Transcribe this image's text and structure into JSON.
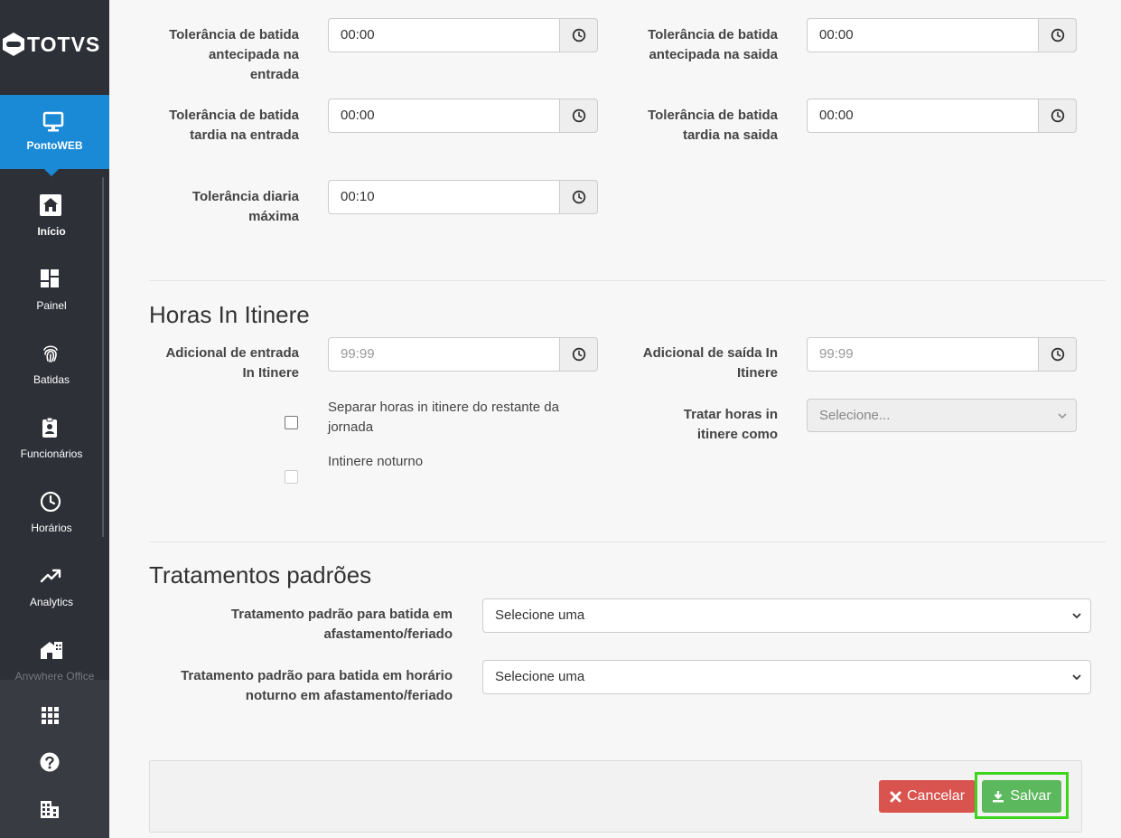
{
  "brand": {
    "logo_text": "TOTVS"
  },
  "sidebar": {
    "items": [
      {
        "label": "PontoWEB",
        "icon": "monitor-icon"
      },
      {
        "label": "Início",
        "icon": "home-icon"
      },
      {
        "label": "Painel",
        "icon": "dashboard-icon"
      },
      {
        "label": "Batidas",
        "icon": "fingerprint-icon"
      },
      {
        "label": "Funcionários",
        "icon": "badge-icon"
      },
      {
        "label": "Horários",
        "icon": "clock-icon"
      },
      {
        "label": "Analytics",
        "icon": "trend-icon"
      },
      {
        "label": "Anywhere Office",
        "icon": "home-office-icon"
      }
    ],
    "bottom_icons": [
      "apps-grid-icon",
      "help-icon",
      "building-icon"
    ]
  },
  "tolerancias": {
    "antecipada_entrada": {
      "label": "Tolerância de batida antecipada na entrada",
      "value": "00:00"
    },
    "antecipada_saida": {
      "label": "Tolerância de batida antecipada na saida",
      "value": "00:00"
    },
    "tardia_entrada": {
      "label": "Tolerância de batida tardia na entrada",
      "value": "00:00"
    },
    "tardia_saida": {
      "label": "Tolerância de batida tardia na saida",
      "value": "00:00"
    },
    "diaria_maxima": {
      "label": "Tolerância diaria máxima",
      "value": "00:10"
    }
  },
  "in_itinere": {
    "title": "Horas In Itinere",
    "adicional_entrada": {
      "label": "Adicional de entrada In Itinere",
      "placeholder": "99:99"
    },
    "adicional_saida": {
      "label": "Adicional de saída In Itinere",
      "placeholder": "99:99"
    },
    "separar_label": "Separar horas in itinere do restante da jornada",
    "separar_checked": false,
    "noturno_label": "Intinere noturno",
    "noturno_checked": false,
    "tratar": {
      "label": "Tratar horas in itinere como",
      "value": "Selecione..."
    }
  },
  "tratamentos": {
    "title": "Tratamentos padrões",
    "afastamento": {
      "label": "Tratamento padrão para batida em afastamento/feriado",
      "value": "Selecione uma"
    },
    "noturno": {
      "label": "Tratamento padrão para batida em horário noturno em afastamento/feriado",
      "value": "Selecione uma"
    }
  },
  "actions": {
    "cancel_label": "Cancelar",
    "save_label": "Salvar"
  },
  "colors": {
    "sidebar": "#2e3038",
    "active": "#1a8ad7",
    "cancel": "#d9534f",
    "save": "#5cb85c",
    "focus": "#3bd51b"
  }
}
